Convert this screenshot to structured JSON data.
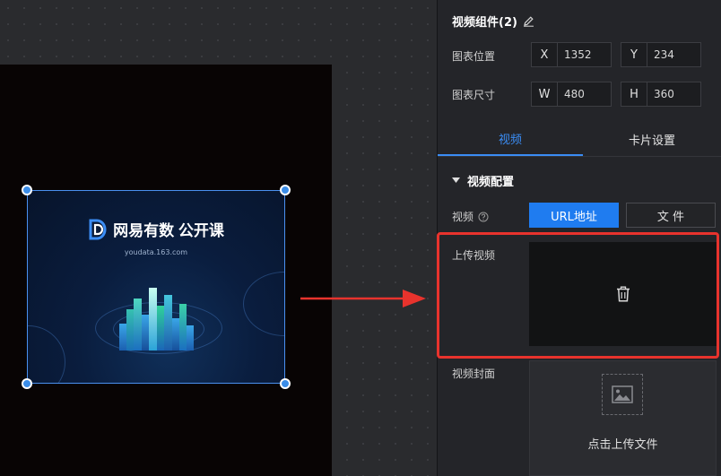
{
  "canvas": {
    "video": {
      "brand_name": "网易有数  公开课",
      "brand_url": "youdata.163.com"
    }
  },
  "panel": {
    "title": "视频组件(2)",
    "position": {
      "label": "图表位置",
      "x_key": "X",
      "x_value": "1352",
      "y_key": "Y",
      "y_value": "234"
    },
    "size": {
      "label": "图表尺寸",
      "w_key": "W",
      "w_value": "480",
      "h_key": "H",
      "h_value": "360"
    },
    "tabs": [
      {
        "label": "视频"
      },
      {
        "label": "卡片设置"
      }
    ],
    "section": "视频配置",
    "video_source": {
      "label": "视频",
      "option_url": "URL地址",
      "option_file": "文 件"
    },
    "upload_video": {
      "label": "上传视频"
    },
    "cover": {
      "label": "视频封面",
      "upload_text": "点击上传文件"
    }
  },
  "colors": {
    "accent": "#1f7cf0",
    "highlight": "#e8332d",
    "selection": "#3b8de8"
  },
  "icons": [
    "edit-icon",
    "help-icon",
    "caret-down-icon",
    "trash-icon",
    "image-icon",
    "arrow-icon"
  ]
}
